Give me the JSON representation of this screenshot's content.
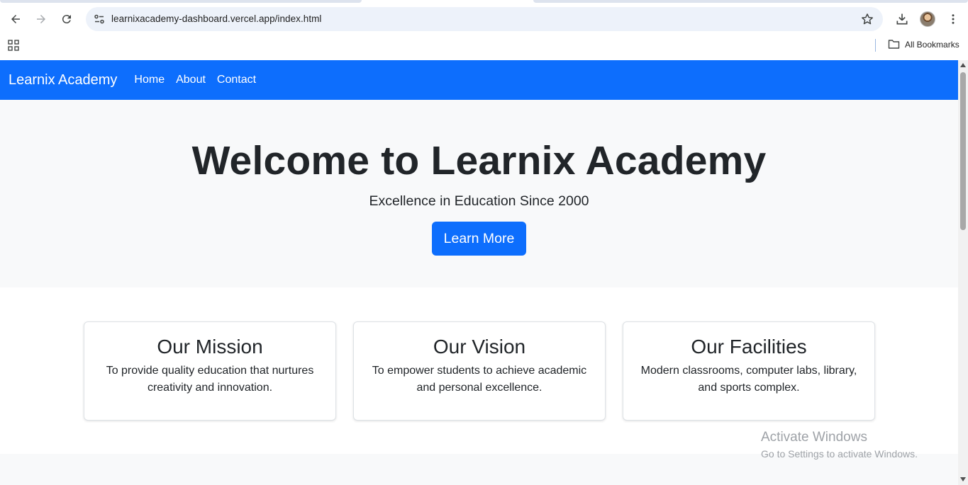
{
  "browser": {
    "url": "learnixacademy-dashboard.vercel.app/index.html",
    "bookmarks_label": "All Bookmarks",
    "icons": [
      "back-icon",
      "forward-icon",
      "reload-icon",
      "site-info-icon",
      "star-icon",
      "download-icon",
      "avatar",
      "menu-icon",
      "apps-icon",
      "folder-icon"
    ]
  },
  "navbar": {
    "brand": "Learnix Academy",
    "links": [
      "Home",
      "About",
      "Contact"
    ],
    "background": "#0d6efd"
  },
  "hero": {
    "title": "Welcome to Learnix Academy",
    "subtitle": "Excellence in Education Since 2000",
    "button_label": "Learn More"
  },
  "cards": [
    {
      "title": "Our Mission",
      "text": "To provide quality education that nurtures creativity and innovation."
    },
    {
      "title": "Our Vision",
      "text": "To empower students to achieve academic and personal excellence."
    },
    {
      "title": "Our Facilities",
      "text": "Modern classrooms, computer labs, library, and sports complex."
    }
  ],
  "watermark": {
    "line1": "Activate Windows",
    "line2": "Go to Settings to activate Windows."
  }
}
